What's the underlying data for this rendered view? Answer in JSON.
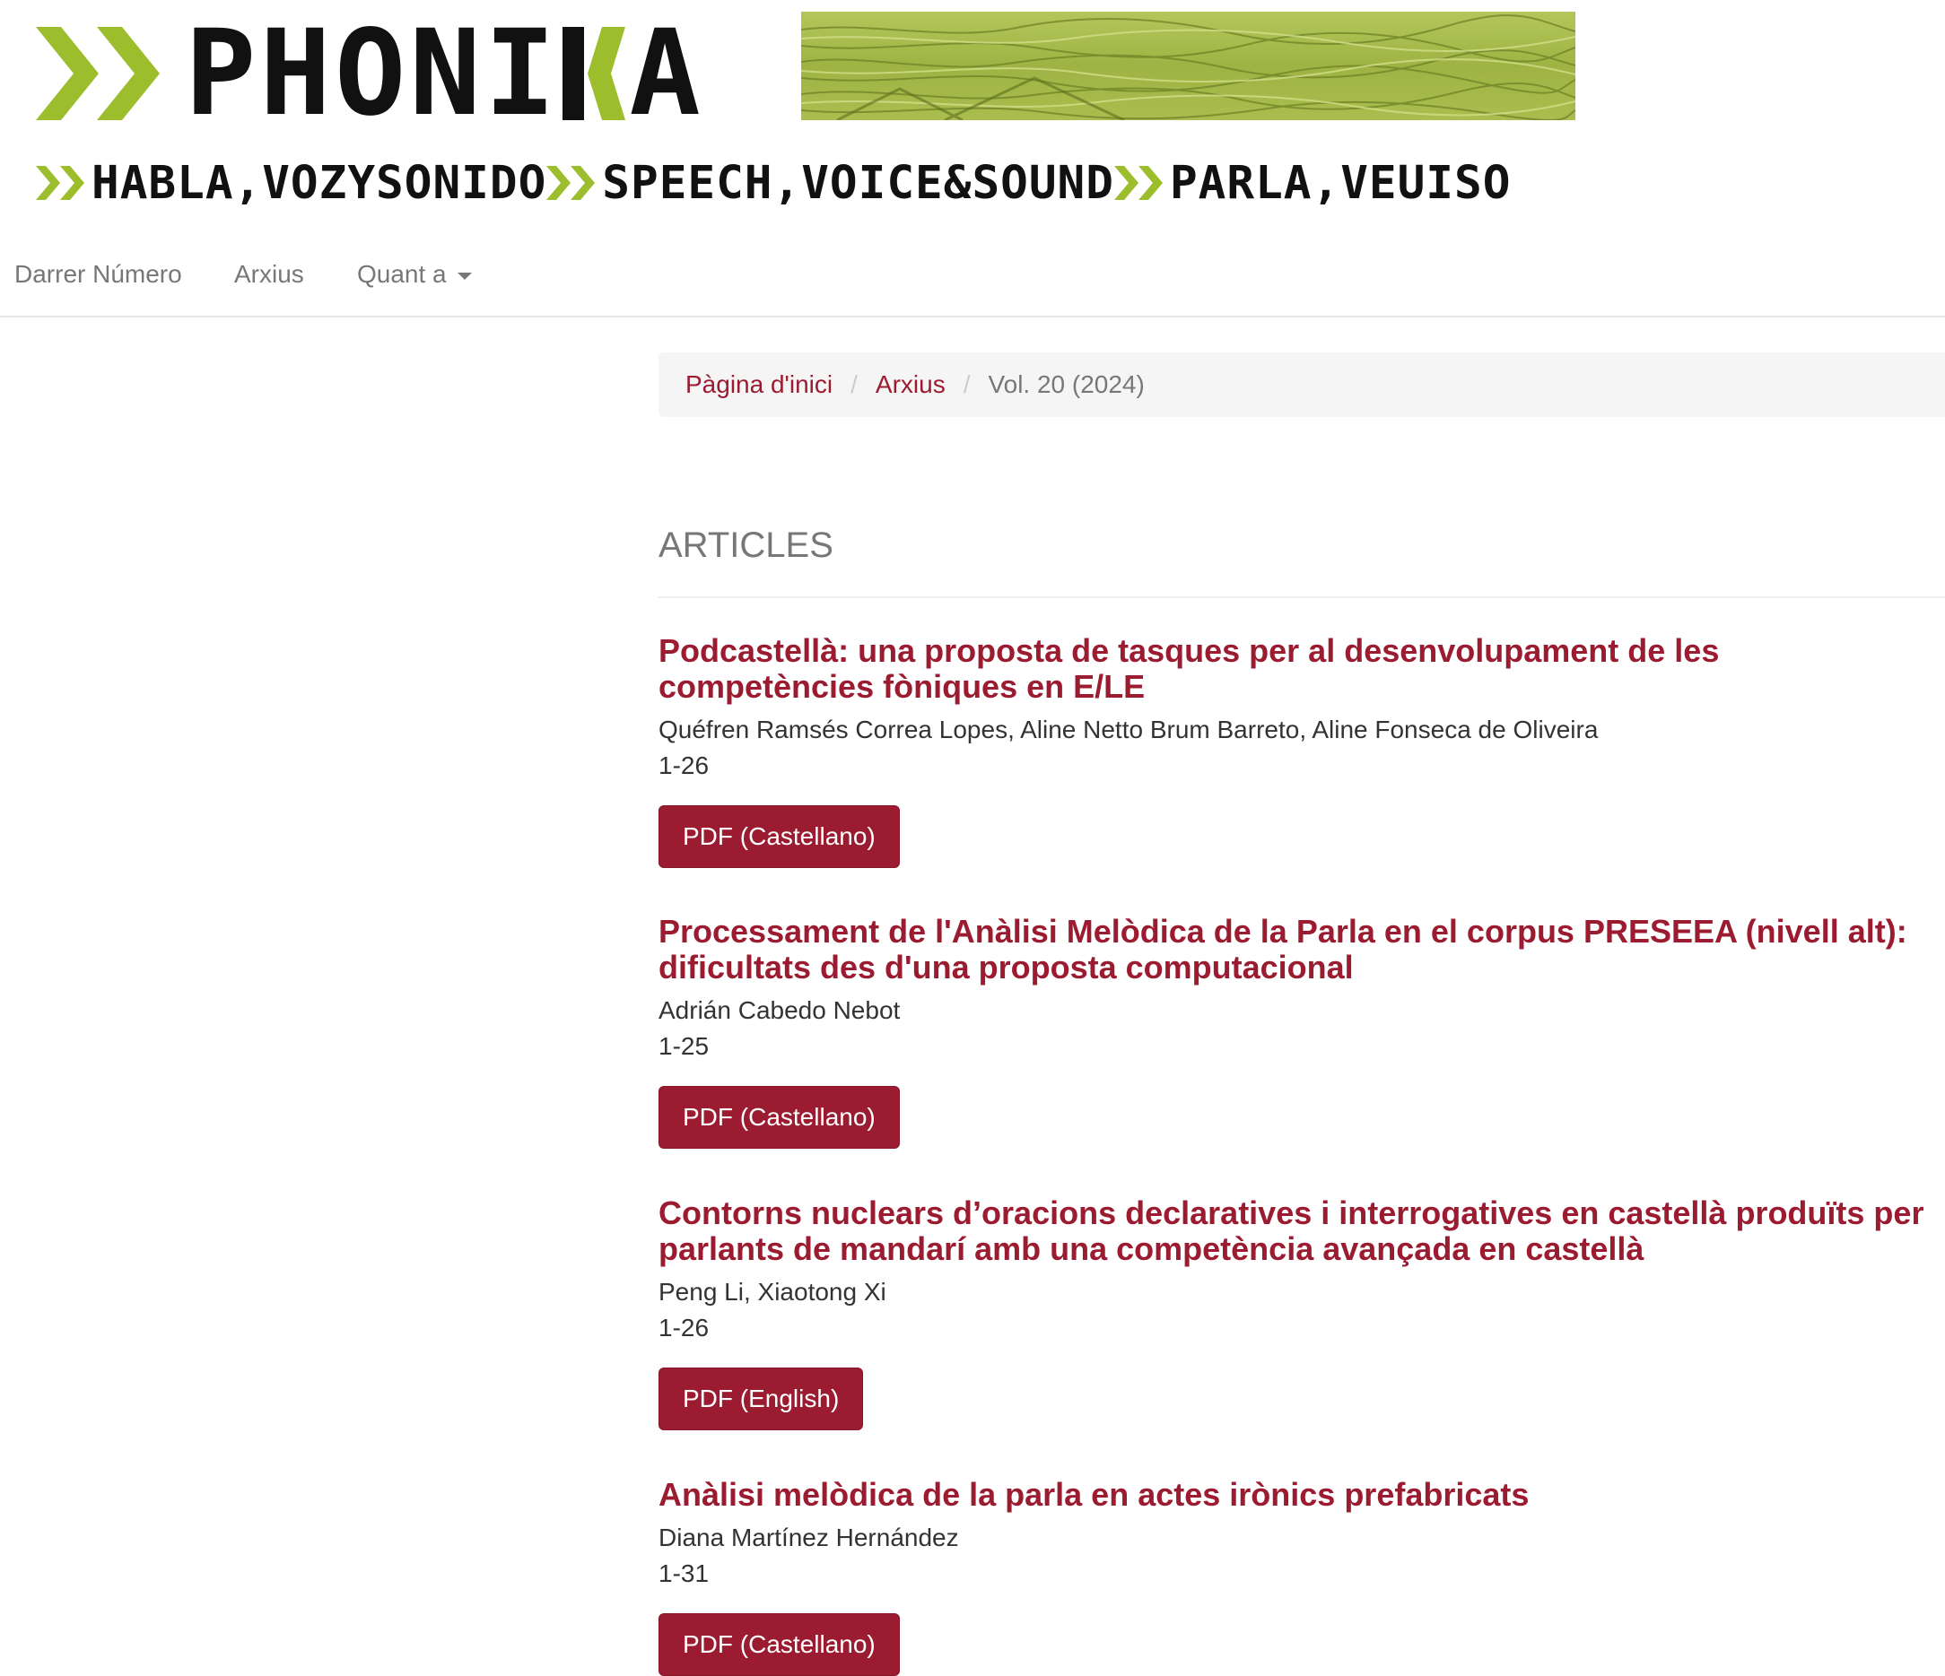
{
  "brand": {
    "name": "PHONICA",
    "tagline": [
      {
        "text": "HABLA,VOZYSONIDO"
      },
      {
        "text": "SPEECH,VOICE&SOUND"
      },
      {
        "text": "PARLA,VEUISO"
      }
    ],
    "accent_color": "#9cbe2c",
    "ink_color": "#111111"
  },
  "nav": {
    "items": [
      {
        "label": "Darrer Número"
      },
      {
        "label": "Arxius"
      },
      {
        "label": "Quant a"
      }
    ]
  },
  "breadcrumb": {
    "home": "Pàgina d'inici",
    "archives": "Arxius",
    "separator": "/",
    "current": "Vol. 20 (2024)"
  },
  "section": {
    "title": "ARTICLES"
  },
  "articles": [
    {
      "title": "Podcastellà: una proposta de tasques per al desenvolupament de les competències fòniques en E/LE",
      "authors": "Quéfren Ramsés Correa Lopes, Aline Netto Brum Barreto, Aline Fonseca de Oliveira",
      "pages": "1-26",
      "button": "PDF (Castellano)"
    },
    {
      "title": "Processament de l'Anàlisi Melòdica de la Parla en el corpus PRESEEA (nivell alt): dificultats des d'una proposta computacional",
      "authors": "Adrián Cabedo Nebot",
      "pages": "1-25",
      "button": "PDF (Castellano)"
    },
    {
      "title": "Contorns nuclears d’oracions declaratives i interrogatives en castellà produïts per parlants de mandarí amb una competència avançada en castellà",
      "authors": "Peng Li, Xiaotong Xi",
      "pages": "1-26",
      "button": "PDF (English)"
    },
    {
      "title": "Anàlisi melòdica de la parla en actes irònics prefabricats",
      "authors": "Diana Martínez Hernández",
      "pages": "1-31",
      "button": "PDF (Castellano)"
    }
  ],
  "colors": {
    "link": "#9b1b30",
    "button_bg": "#9b1b30",
    "button_text": "#ffffff",
    "muted": "#777777",
    "breadcrumb_bg": "#f5f5f5"
  }
}
